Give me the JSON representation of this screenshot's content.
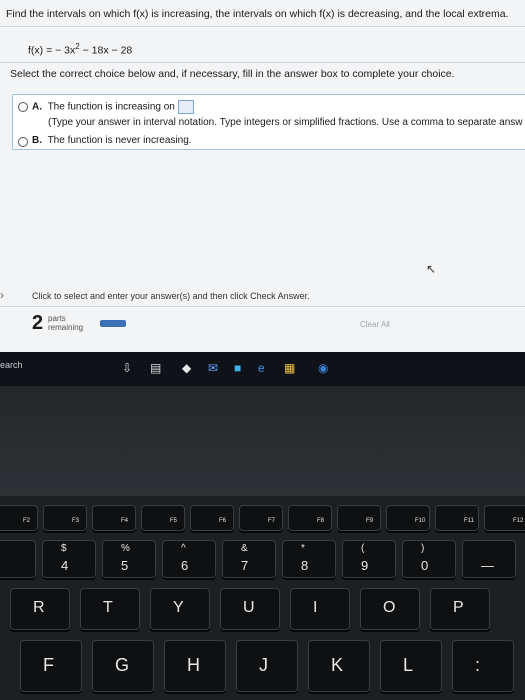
{
  "question": {
    "prompt": "Find the intervals on which f(x) is increasing, the intervals on which f(x) is decreasing, and the local extrema.",
    "function_lhs": "f(x) = − 3x",
    "function_exp": "2",
    "function_rhs": " − 18x − 28",
    "instruction": "Select the correct choice below and, if necessary, fill in the answer box to complete your choice."
  },
  "choices": [
    {
      "letter": "A.",
      "text": "The function is increasing on",
      "subtext": "(Type your answer in interval notation. Type integers or simplified fractions. Use a comma to separate answ"
    },
    {
      "letter": "B.",
      "text": "The function is never increasing."
    }
  ],
  "footer": {
    "hint": "Click to select and enter your answer(s) and then click Check Answer.",
    "parts_count": "2",
    "parts_label_1": "parts",
    "parts_label_2": "remaining",
    "clear_all": "Clear All"
  },
  "taskbar": {
    "search_text": "earch"
  },
  "keyboard": {
    "fn_row": [
      "F2",
      "F3",
      "F4",
      "F5",
      "F6",
      "F7",
      "F8",
      "F9",
      "F10",
      "F11",
      "F12"
    ],
    "num_row": [
      {
        "top": "",
        "bottom": ""
      },
      {
        "top": "$",
        "bottom": "4"
      },
      {
        "top": "%",
        "bottom": "5"
      },
      {
        "top": "^",
        "bottom": "6"
      },
      {
        "top": "&",
        "bottom": "7"
      },
      {
        "top": "*",
        "bottom": "8"
      },
      {
        "top": "(",
        "bottom": "9"
      },
      {
        "top": ")",
        "bottom": "0"
      },
      {
        "top": "",
        "bottom": "—"
      }
    ],
    "row_r": [
      "R",
      "T",
      "Y",
      "U",
      "I",
      "O",
      "P"
    ],
    "row_f": [
      "F",
      "G",
      "H",
      "J",
      "K",
      "L",
      ":"
    ]
  }
}
